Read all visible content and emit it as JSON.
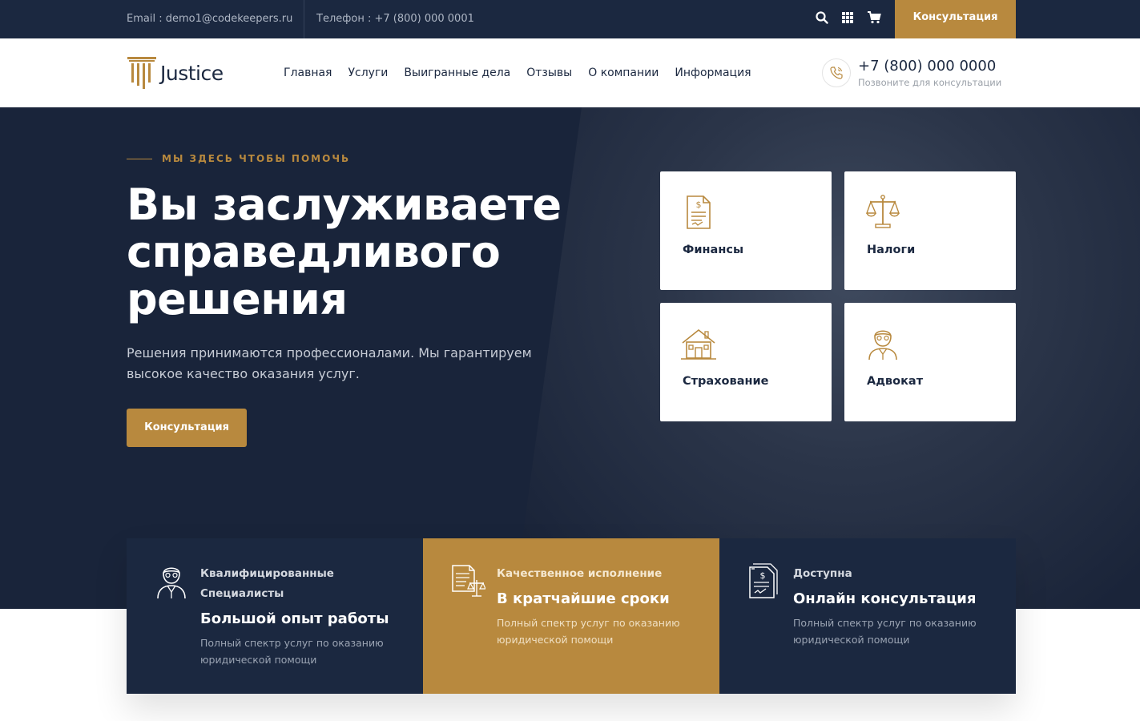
{
  "topbar": {
    "email": "Email : demo1@codekeepers.ru",
    "phone": "Телефон : +7 (800) 000 0001",
    "icons": [
      "search-icon",
      "grid-icon",
      "cart-icon"
    ],
    "cta_label": "Консультация"
  },
  "header": {
    "logo_text": "Justice",
    "nav": [
      "Главная",
      "Услуги",
      "Выигранные дела",
      "Отзывы",
      "О компании",
      "Информация"
    ],
    "phone_number": "+7 (800) 000 0000",
    "phone_caption": "Позвоните для консультации"
  },
  "hero": {
    "eyebrow": "МЫ ЗДЕСЬ ЧТОБЫ ПОМОЧЬ",
    "title_line1": "Вы заслуживаете",
    "title_line2": "справедливого",
    "title_line3": "решения",
    "lead": "Решения принимаются профессионалами. Мы гарантируем высокое качество оказания услуг.",
    "button_label": "Консультация"
  },
  "services": [
    {
      "label": "Финансы",
      "icon": "finance-document-icon"
    },
    {
      "label": "Налоги",
      "icon": "scales-icon"
    },
    {
      "label": "Страхование",
      "icon": "house-icon"
    },
    {
      "label": "Адвокат",
      "icon": "lawyer-icon"
    }
  ],
  "features": [
    {
      "small": "Квалифицированные Специалисты",
      "title": "Большой опыт работы",
      "desc": "Полный спектр услуг по оказанию юридической помощи",
      "icon": "lawyer-icon"
    },
    {
      "small": "Качественное исполнение",
      "title": "В кратчайшие сроки",
      "desc": "Полный спектр услуг по оказанию юридической помощи",
      "icon": "contract-scales-icon"
    },
    {
      "small": "Доступна",
      "title": "Онлайн консультация",
      "desc": "Полный спектр услуг по оказанию юридической помощи",
      "icon": "finance-document-icon"
    }
  ],
  "colors": {
    "navy": "#1b2840",
    "gold": "#b8893e",
    "white": "#ffffff"
  }
}
